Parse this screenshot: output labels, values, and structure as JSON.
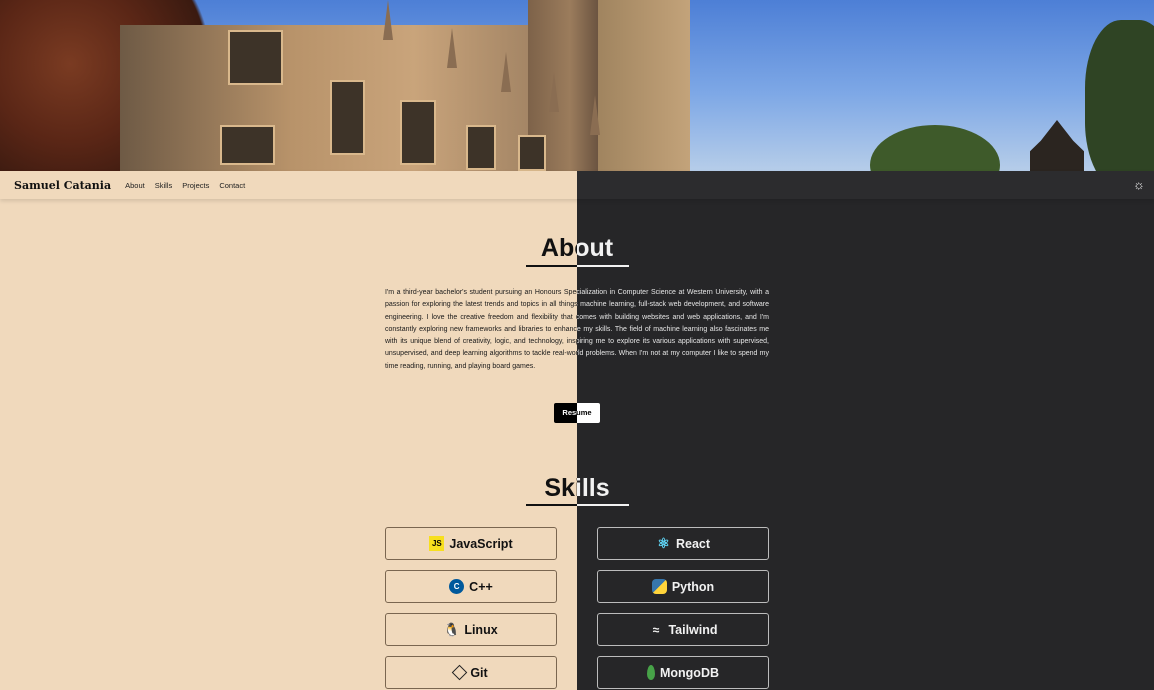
{
  "hero": {
    "alt": ""
  },
  "navbar": {
    "brand": "Samuel Catania",
    "links": [
      "About",
      "Skills",
      "Projects",
      "Contact"
    ]
  },
  "about": {
    "title": "About",
    "paragraph": "I'm a third-year bachelor's student pursuing an Honours Specialization in Computer Science at Western University, with a passion for exploring the latest trends and topics in all things machine learning, full-stack web development, and software engineering. I love the creative freedom and flexibility that comes with building websites and web applications, and I'm constantly exploring new frameworks and libraries to enhance my skills. The field of machine learning also fascinates me with its unique blend of creativity, logic, and technology, inspiring me to explore its various applications with supervised, unsupervised, and deep learning algorithms to tackle real-world problems. When I'm not at my computer I like to spend my time reading, running, and playing board games.",
    "resume_label": "Resume"
  },
  "skills": {
    "title": "Skills",
    "left": [
      {
        "label": "JavaScript",
        "icon": "javascript-icon"
      },
      {
        "label": "C++",
        "icon": "cplusplus-icon"
      },
      {
        "label": "Linux",
        "icon": "linux-icon"
      },
      {
        "label": "Git",
        "icon": "git-icon"
      }
    ],
    "right": [
      {
        "label": "React",
        "icon": "react-icon"
      },
      {
        "label": "Python",
        "icon": "python-icon"
      },
      {
        "label": "Tailwind",
        "icon": "tailwind-icon"
      },
      {
        "label": "MongoDB",
        "icon": "mongodb-icon"
      }
    ]
  },
  "colors": {
    "light_bg": "#f0d9bc",
    "dark_bg": "#262628",
    "text_dark": "#111111",
    "text_light": "#f2f2f2"
  }
}
